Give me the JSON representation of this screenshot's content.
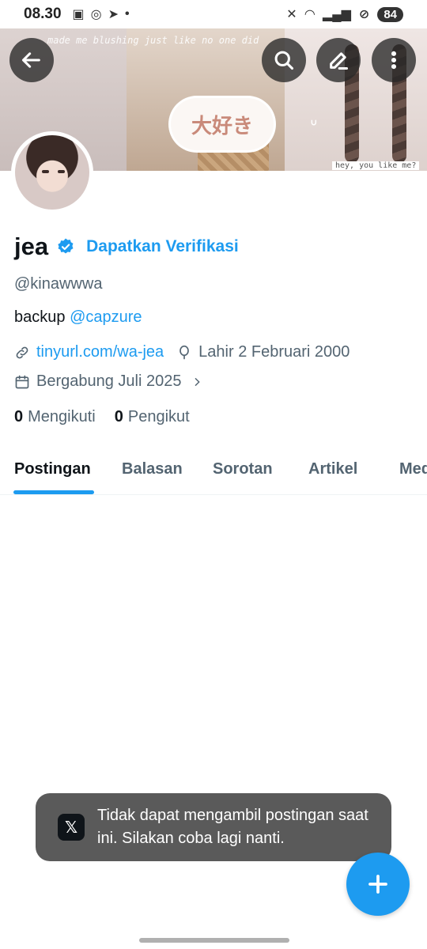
{
  "status_bar": {
    "time": "08.30",
    "battery": "84"
  },
  "banner": {
    "doodle_top": "made me blushing just like no one did",
    "doodle_bottom": "hey, you like me?",
    "kanji": "大好き"
  },
  "profile": {
    "name": "jea",
    "get_verified_label": "Dapatkan Verifikasi",
    "handle": "@kinawwwa",
    "bio_text": "backup ",
    "bio_mention": "@capzure",
    "link": "tinyurl.com/wa-jea",
    "birthday": "Lahir 2 Februari 2000",
    "joined": "Bergabung Juli 2025",
    "following_count": "0",
    "following_label": "Mengikuti",
    "followers_count": "0",
    "followers_label": "Pengikut"
  },
  "tabs": [
    {
      "label": "Postingan",
      "active": true
    },
    {
      "label": "Balasan"
    },
    {
      "label": "Sorotan"
    },
    {
      "label": "Artikel"
    },
    {
      "label": "Media"
    }
  ],
  "toast": {
    "icon": "x-logo-icon",
    "message": "Tidak dapat mengambil postingan saat ini. Silakan coba lagi nanti."
  },
  "colors": {
    "accent": "#1d9bf0",
    "text_primary": "#0f1419",
    "text_secondary": "#536471",
    "toast_bg": "#5a5a5a"
  }
}
